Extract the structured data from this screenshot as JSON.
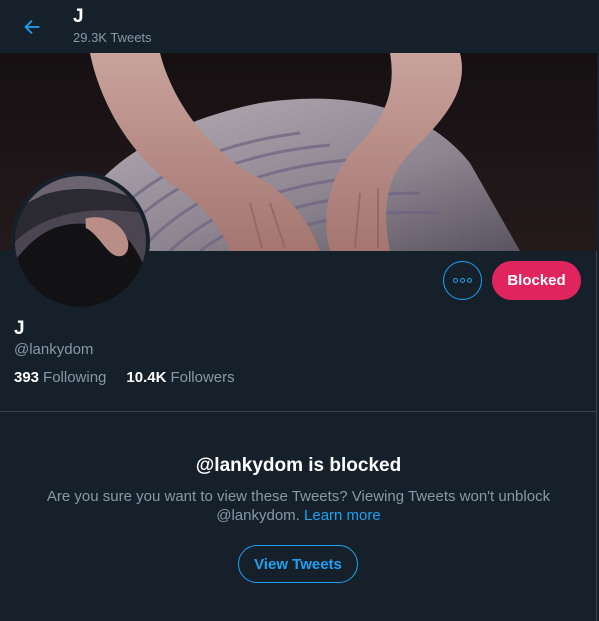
{
  "header": {
    "back_icon": "arrow-left-icon",
    "title": "J",
    "tweet_count": "29.3K Tweets"
  },
  "profile": {
    "display_name": "J",
    "handle": "@lankydom",
    "following_count": "393",
    "following_label": "Following",
    "followers_count": "10.4K",
    "followers_label": "Followers"
  },
  "actions": {
    "more_icon": "more-horizontal-icon",
    "blocked_label": "Blocked"
  },
  "blocked_notice": {
    "title": "@lankydom is blocked",
    "message_line1": "Are you sure you want to view these Tweets? Viewing Tweets won't unblock",
    "message_line2_prefix": "@lankydom.",
    "learn_more": "Learn more",
    "view_button": "View Tweets"
  },
  "colors": {
    "background": "#15202b",
    "accent": "#1da1f2",
    "blocked": "#e0245e",
    "secondary_text": "#8899a6",
    "border": "#38444d"
  }
}
